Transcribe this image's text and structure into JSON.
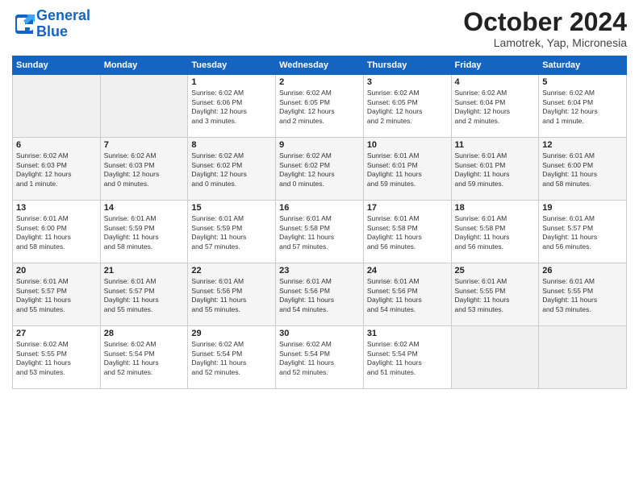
{
  "logo": {
    "line1": "General",
    "line2": "Blue"
  },
  "title": "October 2024",
  "location": "Lamotrek, Yap, Micronesia",
  "headers": [
    "Sunday",
    "Monday",
    "Tuesday",
    "Wednesday",
    "Thursday",
    "Friday",
    "Saturday"
  ],
  "weeks": [
    [
      {
        "num": "",
        "info": "",
        "empty": true
      },
      {
        "num": "",
        "info": "",
        "empty": true
      },
      {
        "num": "1",
        "info": "Sunrise: 6:02 AM\nSunset: 6:06 PM\nDaylight: 12 hours\nand 3 minutes.",
        "empty": false
      },
      {
        "num": "2",
        "info": "Sunrise: 6:02 AM\nSunset: 6:05 PM\nDaylight: 12 hours\nand 2 minutes.",
        "empty": false
      },
      {
        "num": "3",
        "info": "Sunrise: 6:02 AM\nSunset: 6:05 PM\nDaylight: 12 hours\nand 2 minutes.",
        "empty": false
      },
      {
        "num": "4",
        "info": "Sunrise: 6:02 AM\nSunset: 6:04 PM\nDaylight: 12 hours\nand 2 minutes.",
        "empty": false
      },
      {
        "num": "5",
        "info": "Sunrise: 6:02 AM\nSunset: 6:04 PM\nDaylight: 12 hours\nand 1 minute.",
        "empty": false
      }
    ],
    [
      {
        "num": "6",
        "info": "Sunrise: 6:02 AM\nSunset: 6:03 PM\nDaylight: 12 hours\nand 1 minute.",
        "empty": false
      },
      {
        "num": "7",
        "info": "Sunrise: 6:02 AM\nSunset: 6:03 PM\nDaylight: 12 hours\nand 0 minutes.",
        "empty": false
      },
      {
        "num": "8",
        "info": "Sunrise: 6:02 AM\nSunset: 6:02 PM\nDaylight: 12 hours\nand 0 minutes.",
        "empty": false
      },
      {
        "num": "9",
        "info": "Sunrise: 6:02 AM\nSunset: 6:02 PM\nDaylight: 12 hours\nand 0 minutes.",
        "empty": false
      },
      {
        "num": "10",
        "info": "Sunrise: 6:01 AM\nSunset: 6:01 PM\nDaylight: 11 hours\nand 59 minutes.",
        "empty": false
      },
      {
        "num": "11",
        "info": "Sunrise: 6:01 AM\nSunset: 6:01 PM\nDaylight: 11 hours\nand 59 minutes.",
        "empty": false
      },
      {
        "num": "12",
        "info": "Sunrise: 6:01 AM\nSunset: 6:00 PM\nDaylight: 11 hours\nand 58 minutes.",
        "empty": false
      }
    ],
    [
      {
        "num": "13",
        "info": "Sunrise: 6:01 AM\nSunset: 6:00 PM\nDaylight: 11 hours\nand 58 minutes.",
        "empty": false
      },
      {
        "num": "14",
        "info": "Sunrise: 6:01 AM\nSunset: 5:59 PM\nDaylight: 11 hours\nand 58 minutes.",
        "empty": false
      },
      {
        "num": "15",
        "info": "Sunrise: 6:01 AM\nSunset: 5:59 PM\nDaylight: 11 hours\nand 57 minutes.",
        "empty": false
      },
      {
        "num": "16",
        "info": "Sunrise: 6:01 AM\nSunset: 5:58 PM\nDaylight: 11 hours\nand 57 minutes.",
        "empty": false
      },
      {
        "num": "17",
        "info": "Sunrise: 6:01 AM\nSunset: 5:58 PM\nDaylight: 11 hours\nand 56 minutes.",
        "empty": false
      },
      {
        "num": "18",
        "info": "Sunrise: 6:01 AM\nSunset: 5:58 PM\nDaylight: 11 hours\nand 56 minutes.",
        "empty": false
      },
      {
        "num": "19",
        "info": "Sunrise: 6:01 AM\nSunset: 5:57 PM\nDaylight: 11 hours\nand 56 minutes.",
        "empty": false
      }
    ],
    [
      {
        "num": "20",
        "info": "Sunrise: 6:01 AM\nSunset: 5:57 PM\nDaylight: 11 hours\nand 55 minutes.",
        "empty": false
      },
      {
        "num": "21",
        "info": "Sunrise: 6:01 AM\nSunset: 5:57 PM\nDaylight: 11 hours\nand 55 minutes.",
        "empty": false
      },
      {
        "num": "22",
        "info": "Sunrise: 6:01 AM\nSunset: 5:56 PM\nDaylight: 11 hours\nand 55 minutes.",
        "empty": false
      },
      {
        "num": "23",
        "info": "Sunrise: 6:01 AM\nSunset: 5:56 PM\nDaylight: 11 hours\nand 54 minutes.",
        "empty": false
      },
      {
        "num": "24",
        "info": "Sunrise: 6:01 AM\nSunset: 5:56 PM\nDaylight: 11 hours\nand 54 minutes.",
        "empty": false
      },
      {
        "num": "25",
        "info": "Sunrise: 6:01 AM\nSunset: 5:55 PM\nDaylight: 11 hours\nand 53 minutes.",
        "empty": false
      },
      {
        "num": "26",
        "info": "Sunrise: 6:01 AM\nSunset: 5:55 PM\nDaylight: 11 hours\nand 53 minutes.",
        "empty": false
      }
    ],
    [
      {
        "num": "27",
        "info": "Sunrise: 6:02 AM\nSunset: 5:55 PM\nDaylight: 11 hours\nand 53 minutes.",
        "empty": false
      },
      {
        "num": "28",
        "info": "Sunrise: 6:02 AM\nSunset: 5:54 PM\nDaylight: 11 hours\nand 52 minutes.",
        "empty": false
      },
      {
        "num": "29",
        "info": "Sunrise: 6:02 AM\nSunset: 5:54 PM\nDaylight: 11 hours\nand 52 minutes.",
        "empty": false
      },
      {
        "num": "30",
        "info": "Sunrise: 6:02 AM\nSunset: 5:54 PM\nDaylight: 11 hours\nand 52 minutes.",
        "empty": false
      },
      {
        "num": "31",
        "info": "Sunrise: 6:02 AM\nSunset: 5:54 PM\nDaylight: 11 hours\nand 51 minutes.",
        "empty": false
      },
      {
        "num": "",
        "info": "",
        "empty": true
      },
      {
        "num": "",
        "info": "",
        "empty": true
      }
    ]
  ]
}
